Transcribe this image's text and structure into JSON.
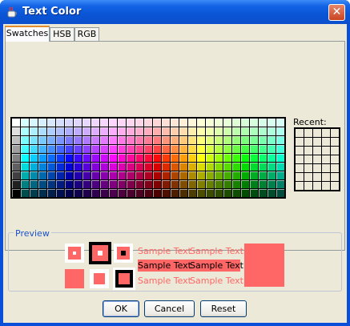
{
  "window": {
    "title": "Text Color",
    "close_label": "✕"
  },
  "tabs": [
    {
      "label": "Swatches",
      "active": true
    },
    {
      "label": "HSB",
      "active": false
    },
    {
      "label": "RGB",
      "active": false
    }
  ],
  "recent": {
    "label": "Recent:"
  },
  "preview": {
    "title": "Preview",
    "color": "#ff6666",
    "sample_text": "Sample Text"
  },
  "buttons": {
    "ok": "OK",
    "cancel": "Cancel",
    "reset": "Reset"
  }
}
